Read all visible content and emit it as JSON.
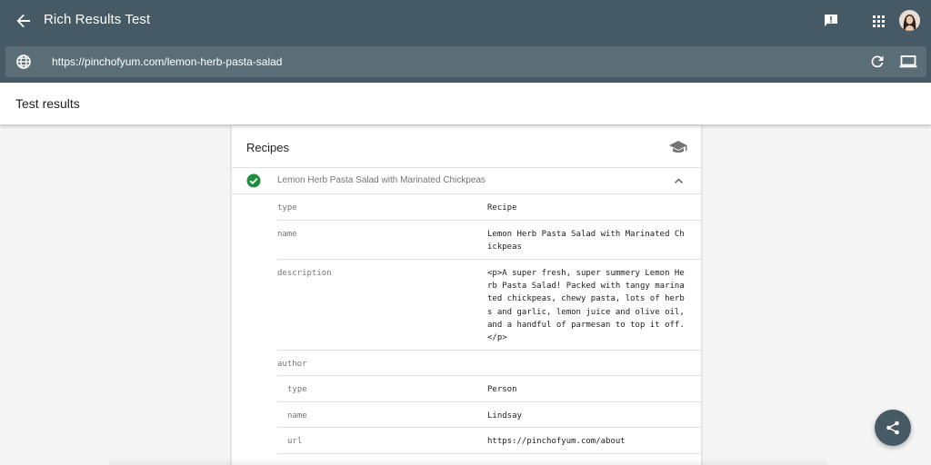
{
  "header": {
    "title": "Rich Results Test",
    "back_icon": "arrow-back-icon",
    "feedback_icon": "feedback-icon",
    "apps_icon": "apps-grid-icon",
    "avatar_icon": "user-avatar"
  },
  "urlbar": {
    "globe_icon": "globe-icon",
    "url": "https://pinchofyum.com/lemon-herb-pasta-salad",
    "refresh_icon": "refresh-icon",
    "device_icon": "desktop-icon"
  },
  "results": {
    "title": "Test results"
  },
  "card": {
    "title": "Recipes",
    "cap_icon": "school-cap-icon",
    "item": {
      "label": "Lemon Herb Pasta Salad with Marinated Chickpeas",
      "status_icon": "check-circle-icon",
      "expand_icon": "chevron-up-icon"
    },
    "properties": [
      {
        "key": "type",
        "value": "Recipe",
        "nested": false
      },
      {
        "key": "name",
        "value": "Lemon Herb Pasta Salad with Marinated Chickpeas",
        "nested": false
      },
      {
        "key": "description",
        "value": "<p>A super fresh, super summery Lemon Herb Pasta Salad! Packed with tangy marinated chickpeas, chewy pasta, lots of herbs and garlic, lemon juice and olive oil, and a handful of parmesan to top it off.</p>",
        "nested": false
      },
      {
        "key": "author",
        "value": "",
        "nested": false
      },
      {
        "key": "type",
        "value": "Person",
        "nested": true
      },
      {
        "key": "name",
        "value": "Lindsay",
        "nested": true
      },
      {
        "key": "url",
        "value": "https://pinchofyum.com/about",
        "nested": true
      }
    ]
  },
  "fab": {
    "icon": "share-icon"
  },
  "colors": {
    "topbar": "#455a64",
    "urlbar": "#5b6e78",
    "success": "#1e8e3e"
  }
}
